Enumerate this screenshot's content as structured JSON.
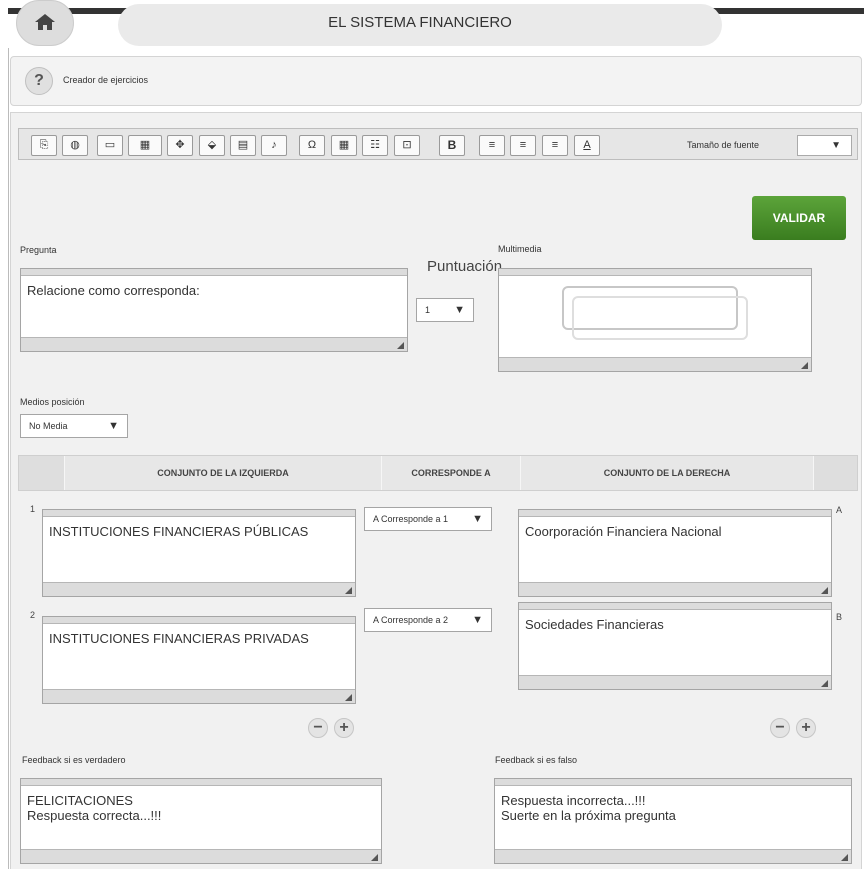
{
  "header": {
    "title": "EL SISTEMA FINANCIERO"
  },
  "helpbar": {
    "icon": "?",
    "label": "Creador de ejercicios"
  },
  "toolbar": {
    "icons": [
      "clipboard-icon",
      "globe-icon",
      "image-icon",
      "gallery-icon",
      "link-icon",
      "upload-icon",
      "video-icon",
      "music-note-icon",
      "omega-icon",
      "table-icon",
      "list-icon",
      "code-icon",
      "bold-icon",
      "align-left-icon",
      "align-center-icon",
      "align-right-icon",
      "font-color-icon"
    ],
    "glyphs": [
      "⎘",
      "◍",
      "▭",
      "▦",
      "✥",
      "⬙",
      "▤",
      "♪",
      "Ω",
      "▦",
      "☷",
      "⊡",
      "B",
      "≡",
      "≡",
      "≡",
      "A"
    ],
    "font_size_label": "Tamaño de fuente",
    "font_size_value": ""
  },
  "validate_label": "VALIDAR",
  "question": {
    "label": "Pregunta",
    "text": "Relacione como corresponda:"
  },
  "score": {
    "label": "Puntuación",
    "value": "1"
  },
  "multimedia": {
    "label": "Multimedia"
  },
  "media_position": {
    "label": "Medios posición",
    "value": "No Media"
  },
  "table": {
    "headers": [
      "CONJUNTO DE LA IZQUIERDA",
      "CORRESPONDE A",
      "CONJUNTO DE LA DERECHA"
    ],
    "rows": [
      {
        "num": "1",
        "left": "INSTITUCIONES FINANCIERAS PÚBLICAS",
        "match": "A Corresponde a 1",
        "right": "Coorporación Financiera Nacional",
        "letter": "A"
      },
      {
        "num": "2",
        "left": "INSTITUCIONES FINANCIERAS PRIVADAS",
        "match": "A Corresponde a 2",
        "right": "Sociedades Financieras",
        "letter": "B"
      }
    ]
  },
  "controls": {
    "minus": "−",
    "plus": "+"
  },
  "feedback_true": {
    "label": "Feedback si es verdadero",
    "text": "FELICITACIONES\nRespuesta correcta...!!!"
  },
  "feedback_false": {
    "label": "Feedback si es falso",
    "text": "Respuesta incorrecta...!!!\nSuerte en la próxima pregunta"
  },
  "arrow_glyph": "▼"
}
